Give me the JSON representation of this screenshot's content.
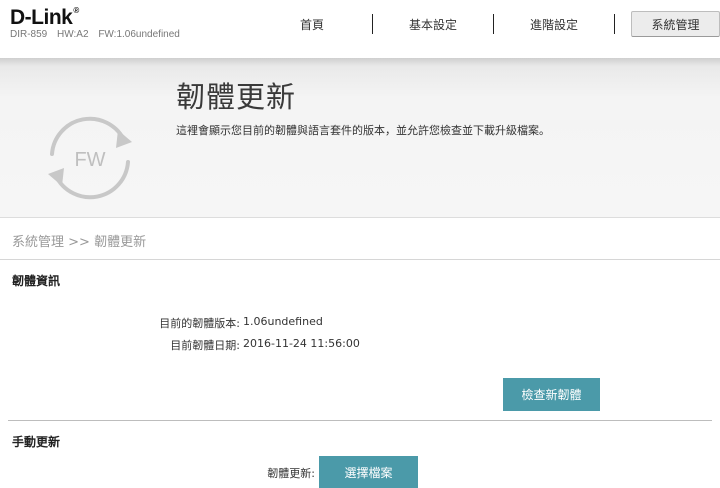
{
  "header": {
    "logo": "D-Link",
    "logo_mark": "®",
    "model": "DIR-859",
    "hw": "HW:A2",
    "fw": "FW:1.06undefined",
    "nav": {
      "home": "首頁",
      "basic": "基本設定",
      "advanced": "進階設定",
      "management": "系統管理"
    }
  },
  "banner": {
    "icon_text": "FW",
    "title": "韌體更新",
    "description": "這裡會顯示您目前的韌體與語言套件的版本，並允許您檢查並下載升級檔案。"
  },
  "breadcrumb": {
    "parent": "系統管理",
    "separator": ">>",
    "current": "韌體更新"
  },
  "firmware_info": {
    "title": "韌體資訊",
    "version_label": "目前的韌體版本:",
    "version_value": "1.06undefined",
    "date_label": "目前韌體日期:",
    "date_value": "2016-11-24 11:56:00",
    "check_button": "檢查新韌體"
  },
  "manual_update": {
    "title": "手動更新",
    "label": "韌體更新:",
    "choose_button": "選擇檔案"
  },
  "colors": {
    "accent": "#4b9aa9",
    "icon_gray": "#c8c8c8"
  }
}
